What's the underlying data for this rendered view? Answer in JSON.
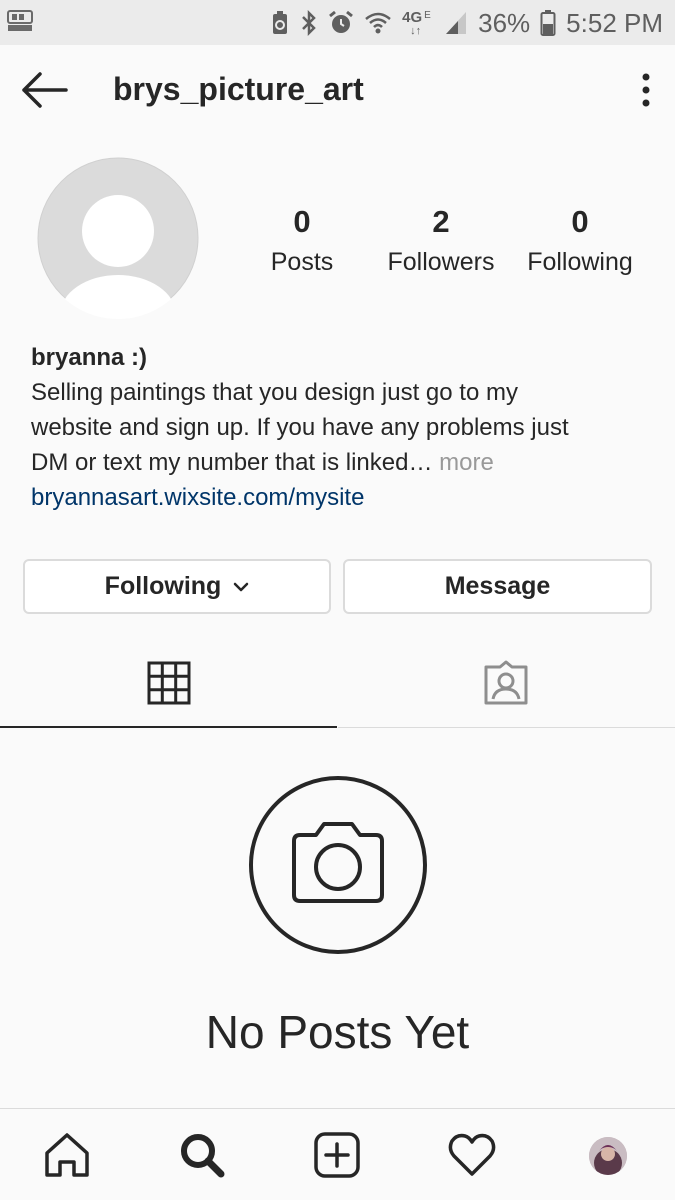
{
  "status_bar": {
    "battery_percent": "36%",
    "time": "5:52 PM",
    "network": "4G",
    "network_sub": "E",
    "icons": [
      "blast-app-icon",
      "recycle-icon",
      "bluetooth-icon",
      "alarm-icon",
      "wifi-icon",
      "signal-icon",
      "battery-icon"
    ]
  },
  "header": {
    "username": "brys_picture_art",
    "icons": [
      "back-arrow-icon",
      "more-vertical-icon"
    ]
  },
  "profile": {
    "stats": {
      "posts": {
        "value": "0",
        "label": "Posts"
      },
      "followers": {
        "value": "2",
        "label": "Followers"
      },
      "following": {
        "value": "0",
        "label": "Following"
      }
    },
    "bio": {
      "name": "bryanna :)",
      "line1": "Selling paintings that you design just go to my",
      "line2": "website and sign up. If you have any problems just",
      "line3": "DM or text my number that is linked…",
      "more": " more",
      "link": "bryannasart.wixsite.com/mysite"
    }
  },
  "actions": {
    "following_label": "Following",
    "message_label": "Message"
  },
  "tabs": {
    "active": "grid",
    "items": [
      "grid-icon",
      "tagged-icon"
    ]
  },
  "empty_state": {
    "text": "No Posts Yet",
    "icon": "camera-icon"
  },
  "bottom_nav": {
    "items": [
      "home-icon",
      "search-icon",
      "add-icon",
      "heart-icon",
      "profile-avatar"
    ]
  },
  "colors": {
    "background": "#fafafa",
    "text": "#262626",
    "link": "#003569",
    "muted": "#999999",
    "border": "#dbdbdb",
    "status_bar": "#ebebeb"
  }
}
